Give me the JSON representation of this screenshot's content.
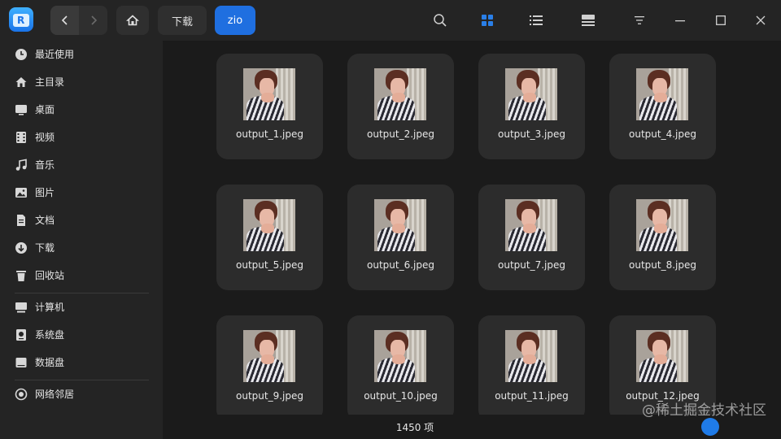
{
  "app": {
    "icon": "file-manager-icon",
    "logo_char": "R"
  },
  "toolbar": {
    "back_icon": "chevron-left-icon",
    "forward_icon": "chevron-right-icon",
    "home_icon": "home-icon",
    "breadcrumbs": [
      {
        "label": "下载",
        "active": false
      },
      {
        "label": "zio",
        "active": true
      }
    ],
    "right_icons": [
      "search-icon",
      "grid-view-icon",
      "list-view-icon",
      "detail-view-icon",
      "menu-icon",
      "minimize-icon",
      "maximize-icon",
      "close-icon"
    ],
    "accent": "#1f6fe0"
  },
  "sidebar": {
    "items": [
      {
        "label": "最近使用",
        "icon": "clock-icon"
      },
      {
        "label": "主目录",
        "icon": "home-icon"
      },
      {
        "label": "桌面",
        "icon": "desktop-icon"
      },
      {
        "label": "视频",
        "icon": "video-icon"
      },
      {
        "label": "音乐",
        "icon": "music-icon"
      },
      {
        "label": "图片",
        "icon": "image-icon"
      },
      {
        "label": "文档",
        "icon": "document-icon"
      },
      {
        "label": "下载",
        "icon": "download-icon"
      },
      {
        "label": "回收站",
        "icon": "trash-icon"
      },
      {
        "label": "计算机",
        "icon": "computer-icon"
      },
      {
        "label": "系统盘",
        "icon": "disk-icon"
      },
      {
        "label": "数据盘",
        "icon": "disk-icon"
      },
      {
        "label": "网络邻居",
        "icon": "network-icon"
      }
    ]
  },
  "files": [
    {
      "name": "output_1.jpeg"
    },
    {
      "name": "output_2.jpeg"
    },
    {
      "name": "output_3.jpeg"
    },
    {
      "name": "output_4.jpeg"
    },
    {
      "name": "output_5.jpeg"
    },
    {
      "name": "output_6.jpeg"
    },
    {
      "name": "output_7.jpeg"
    },
    {
      "name": "output_8.jpeg"
    },
    {
      "name": "output_9.jpeg"
    },
    {
      "name": "output_10.jpeg"
    },
    {
      "name": "output_11.jpeg"
    },
    {
      "name": "output_12.jpeg"
    }
  ],
  "status": {
    "count": "1450 项"
  },
  "watermark": "@稀土掘金技术社区"
}
